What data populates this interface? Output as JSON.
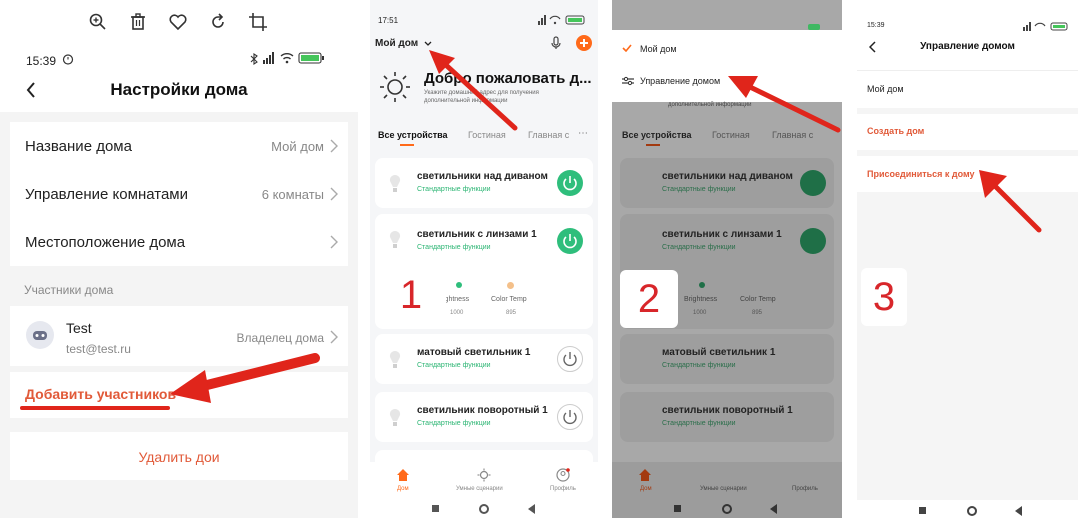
{
  "panel1": {
    "time": "15:39",
    "title": "Настройки дома",
    "rows": [
      {
        "label": "Название дома",
        "value": "Мой дом"
      },
      {
        "label": "Управление комнатами",
        "value": "6 комнаты"
      },
      {
        "label": "Местоположение дома",
        "value": ""
      }
    ],
    "members_section": "Участники дома",
    "member": {
      "name": "Test",
      "email": "test@test.ru",
      "role": "Владелец дома"
    },
    "add_members": "Добавить участников",
    "delete_home": "Удалить дои"
  },
  "panel2": {
    "time": "17:51",
    "home_name": "Мой дом",
    "welcome_title": "Добро пожаловать д...",
    "welcome_sub": "Укажите домашний адрес для получения дополнительной информации",
    "tabs": [
      "Все устройства",
      "Гостиная",
      "Главная с"
    ],
    "devices": [
      {
        "name": "светильники над диваном",
        "sub": "Стандартные функции"
      },
      {
        "name": "светильник с линзами 1",
        "sub": "Стандартные функции"
      },
      {
        "name": "матовый светильник 1",
        "sub": "Стандартные функции"
      },
      {
        "name": "светильник поворотный 1",
        "sub": "Стандартные функции"
      }
    ],
    "brightness_label": "ightness",
    "brightness_value": "1000",
    "colortemp_label": "Color Temp",
    "colortemp_value": "895",
    "nav": [
      "Дом",
      "Умные сценарии",
      "Профиль"
    ],
    "step": "1"
  },
  "panel3": {
    "menu_home": "Мой дом",
    "menu_manage": "Управление домом",
    "sub_info": "дополнительной информации",
    "tabs": [
      "Все устройства",
      "Гостиная",
      "Главная с"
    ],
    "devices": [
      {
        "name": "светильники над диваном",
        "sub": "Стандартные функции"
      },
      {
        "name": "светильник с линзами 1",
        "sub": "Стандартные функции"
      },
      {
        "name": "матовый светильник 1",
        "sub": "Стандартные функции"
      },
      {
        "name": "светильник поворотный 1",
        "sub": "Стандартные функции"
      }
    ],
    "brightness_label": "Brightness",
    "brightness_value": "1000",
    "colortemp_label": "Color Temp",
    "colortemp_value": "895",
    "nav": [
      "Дом",
      "Умные сценарии",
      "Профиль"
    ],
    "step": "2"
  },
  "panel4": {
    "time": "15:39",
    "title": "Управление домом",
    "home": "Мой дом",
    "create": "Создать дом",
    "join": "Присоединиться к дому",
    "step": "3"
  },
  "colors": {
    "red": "#e0251b",
    "green": "#2fbe7c",
    "orange": "#ff6a1a",
    "link": "#e15a39"
  },
  "icons": [
    "zoom-icon",
    "trash-icon",
    "heart-icon",
    "rotate-icon",
    "crop-icon",
    "back-icon",
    "chevron-right-icon",
    "avatar-icon",
    "sun-icon",
    "power-icon",
    "bulb-icon",
    "home-icon",
    "check-icon",
    "settings-icon",
    "mic-icon",
    "plus-icon"
  ]
}
